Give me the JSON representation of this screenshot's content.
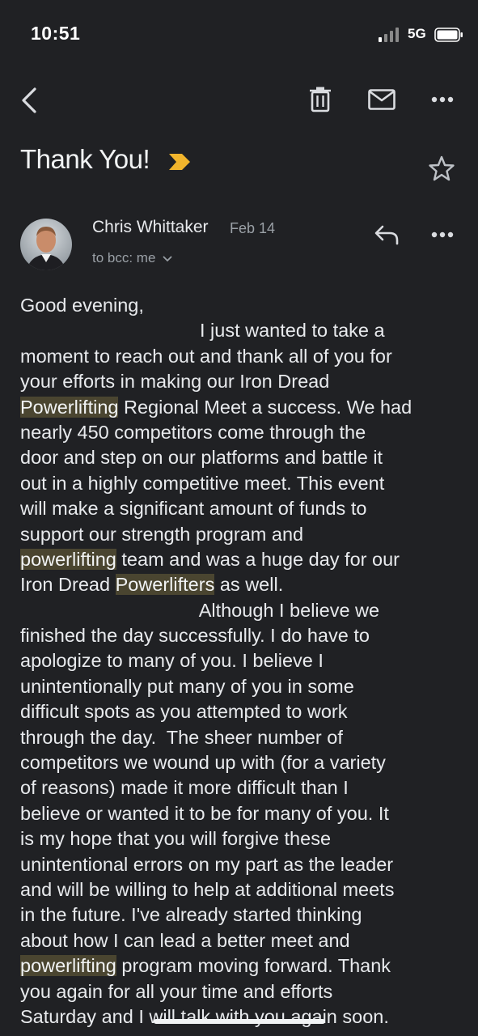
{
  "status_bar": {
    "time": "10:51",
    "network": "5G"
  },
  "toolbar": {
    "back_icon": "chevron-left-icon",
    "delete_icon": "trash-icon",
    "mark_unread_icon": "mail-icon",
    "more_icon": "more-horizontal-icon"
  },
  "email": {
    "subject": "Thank You!",
    "label_icon": "important-marker-icon",
    "label_color": "#F2B52C",
    "sender": "Chris Whittaker",
    "date": "Feb 14",
    "recipients": "to bcc: me",
    "body_lines": [
      "Good evening,",
      "                                  I just wanted to take a",
      "moment to reach out and thank all of you for",
      "your efforts in making our Iron Dread",
      "Powerlifting Regional Meet a success. We had",
      "nearly 450 competitors come through the",
      "door and step on our platforms and battle it",
      "out in a highly competitive meet. This event",
      "will make a significant amount of funds to",
      "support our strength program and",
      "powerlifting team and was a huge day for our",
      "Iron Dread Powerlifters as well.",
      "                                  Although I believe we",
      "finished the day successfully. I do have to",
      "apologize to many of you. I believe I",
      "unintentionally put many of you in some",
      "difficult spots as you attempted to work",
      "through the day.  The sheer number of",
      "competitors we wound up with (for a variety",
      "of reasons) made it more difficult than I",
      "believe or wanted it to be for many of you. It",
      "is my hope that you will forgive these",
      "unintentional errors on my part as the leader",
      "and will be willing to help at additional meets",
      "in the future. I've already started thinking",
      "about how I can lead a better meet and",
      "powerlifting program moving forward. Thank",
      "you again for all your time and efforts",
      "Saturday and I will talk with you again soon."
    ],
    "highlight_terms": [
      "Powerlifting",
      "powerlifting",
      "Powerlifters"
    ],
    "highlight_color": "#4A4530"
  }
}
